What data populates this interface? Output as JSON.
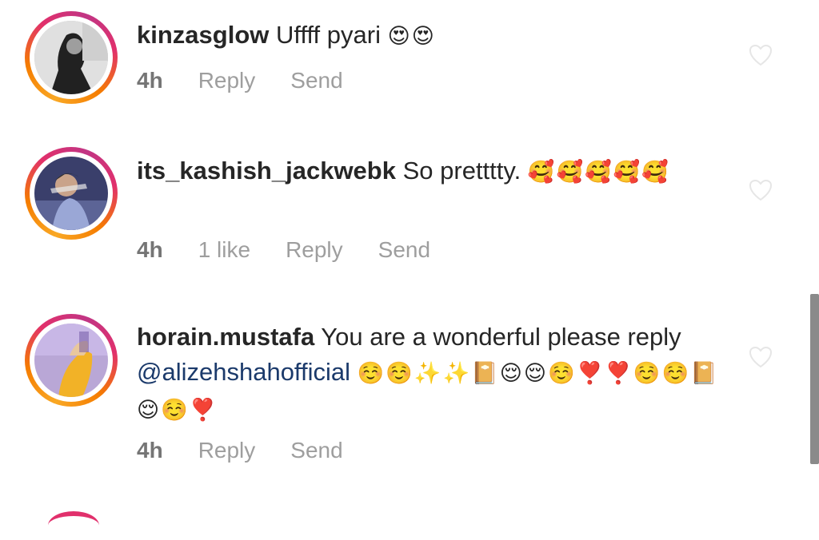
{
  "comments": [
    {
      "username": "kinzasglow",
      "text": "Uffff pyari",
      "emoji": "😍😍",
      "time": "4h",
      "likes": "",
      "reply_label": "Reply",
      "send_label": "Send"
    },
    {
      "username": "its_kashish_jackwebk",
      "text": "So pretttty.",
      "emoji": "🥰🥰🥰🥰🥰",
      "time": "4h",
      "likes": "1 like",
      "reply_label": "Reply",
      "send_label": "Send"
    },
    {
      "username": "horain.mustafa",
      "text": "You are a wonderful please reply",
      "mention": "@alizehshahofficial",
      "emoji": "☺️☺️✨✨📔😌😌☺️❣️❣️☺️☺️📔😌☺️❣️",
      "time": "4h",
      "likes": "",
      "reply_label": "Reply",
      "send_label": "Send"
    }
  ],
  "icons": {
    "like": "heart-outline-icon"
  },
  "colors": {
    "story_ring_start": "#f9a825",
    "story_ring_end": "#c13584",
    "mention": "#1b3a6b",
    "meta": "#9e9e9e"
  }
}
